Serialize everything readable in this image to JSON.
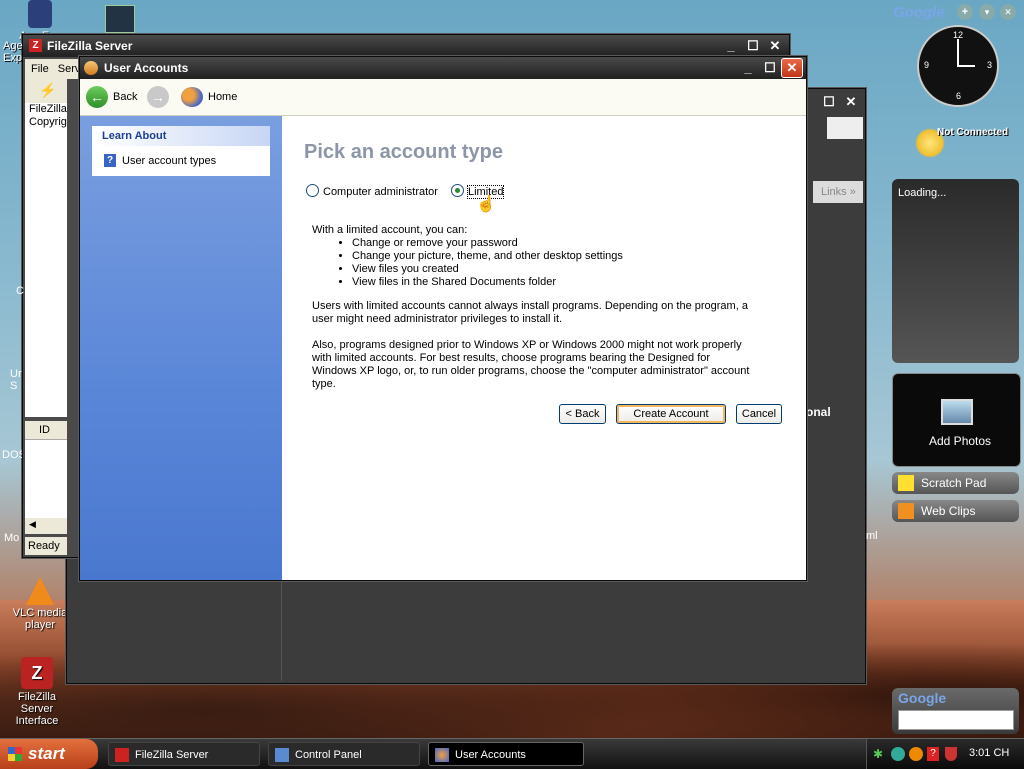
{
  "desktop": {
    "icons": [
      {
        "label": "Age Exp"
      },
      {
        "label": "VLC media player"
      },
      {
        "label": "FileZilla Server Interface"
      }
    ],
    "edge_labels": [
      "C",
      "Ur S",
      "DOS",
      "Mo",
      "onal",
      "ml"
    ]
  },
  "filezilla": {
    "title": "FileZilla Server",
    "menu": [
      "File",
      "Serv"
    ],
    "log_lines": [
      "FileZilla",
      "Copyrig"
    ],
    "table_header": "ID",
    "status": "Ready"
  },
  "user_accounts": {
    "title": "User Accounts",
    "nav": {
      "back": "Back",
      "home": "Home"
    },
    "learn_about": {
      "header": "Learn About",
      "items": [
        "User account types"
      ]
    },
    "heading": "Pick an account type",
    "options": [
      {
        "label": "Computer administrator",
        "selected": false
      },
      {
        "label": "Limited",
        "selected": true
      }
    ],
    "intro": "With a limited account, you can:",
    "bullets": [
      "Change or remove your password",
      "Change your picture, theme, and other desktop settings",
      "View files you created",
      "View files in the Shared Documents folder"
    ],
    "para1": "Users with limited accounts cannot always install programs. Depending on the program, a user might need administrator privileges to install it.",
    "para2": "Also, programs designed prior to Windows XP or Windows 2000 might not work properly with limited accounts. For best results, choose programs bearing the Designed for Windows XP logo, or, to run older programs, choose the \"computer administrator\" account type.",
    "buttons": {
      "back": "< Back",
      "create": "Create Account",
      "cancel": "Cancel"
    }
  },
  "control_panel": {
    "links": "Links"
  },
  "sidebar": {
    "brand": "Google",
    "clock": {
      "hours": [
        "12",
        "3",
        "6",
        "9"
      ]
    },
    "status": "Not Connected",
    "loading": "Loading...",
    "add_photos": "Add Photos",
    "scratch_pad": "Scratch Pad",
    "web_clips": "Web Clips",
    "search_brand": "Google"
  },
  "taskbar": {
    "start": "start",
    "tasks": [
      "FileZilla Server",
      "Control Panel",
      "User Accounts"
    ],
    "clock": "3:01 CH"
  },
  "colors": {
    "accent": "#f3b65a",
    "xp_blue": "#5a86d8",
    "start_orange": "#d45a2a"
  }
}
